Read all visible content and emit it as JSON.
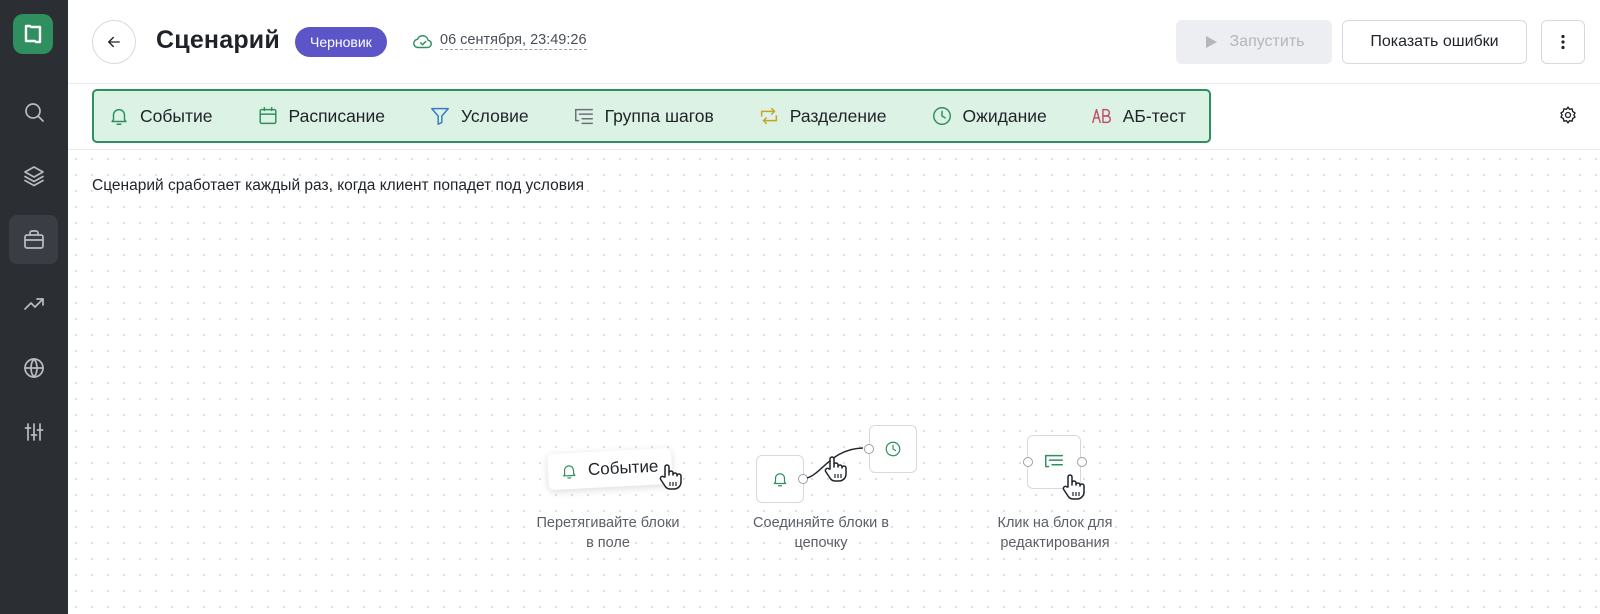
{
  "sidebar": {
    "items": [
      {
        "icon": "search-icon"
      },
      {
        "icon": "layers-icon"
      },
      {
        "icon": "briefcase-icon",
        "active": true
      },
      {
        "icon": "trending-icon"
      },
      {
        "icon": "globe-icon"
      },
      {
        "icon": "sliders-icon"
      }
    ]
  },
  "header": {
    "title": "Сценарий",
    "status": "Черновик",
    "saved_at": "06 сентября, 23:49:26",
    "run_label": "Запустить",
    "errors_label": "Показать ошибки"
  },
  "palette": {
    "items": [
      {
        "label": "Событие",
        "icon": "bell-icon"
      },
      {
        "label": "Расписание",
        "icon": "calendar-icon"
      },
      {
        "label": "Условие",
        "icon": "filter-icon"
      },
      {
        "label": "Группа шагов",
        "icon": "step-group-icon"
      },
      {
        "label": "Разделение",
        "icon": "split-icon"
      },
      {
        "label": "Ожидание",
        "icon": "clock-icon"
      },
      {
        "label": "АБ-тест",
        "icon": "ab-test-icon"
      }
    ]
  },
  "canvas": {
    "hint": "Сценарий сработает каждый раз, когда клиент попадет под условия",
    "tips": [
      {
        "caption_line1": "Перетягивайте блоки",
        "caption_line2": "в поле",
        "demo_label": "Событие"
      },
      {
        "caption_line1": "Соединяйте блоки в",
        "caption_line2": "цепочку"
      },
      {
        "caption_line1": "Клик на блок для",
        "caption_line2": "редактирования"
      }
    ]
  },
  "colors": {
    "sidebar_bg": "#2b2e33",
    "brand_green": "#2f8f5f",
    "palette_bg": "#dcf2e4",
    "draft_badge": "#5b55c8"
  }
}
